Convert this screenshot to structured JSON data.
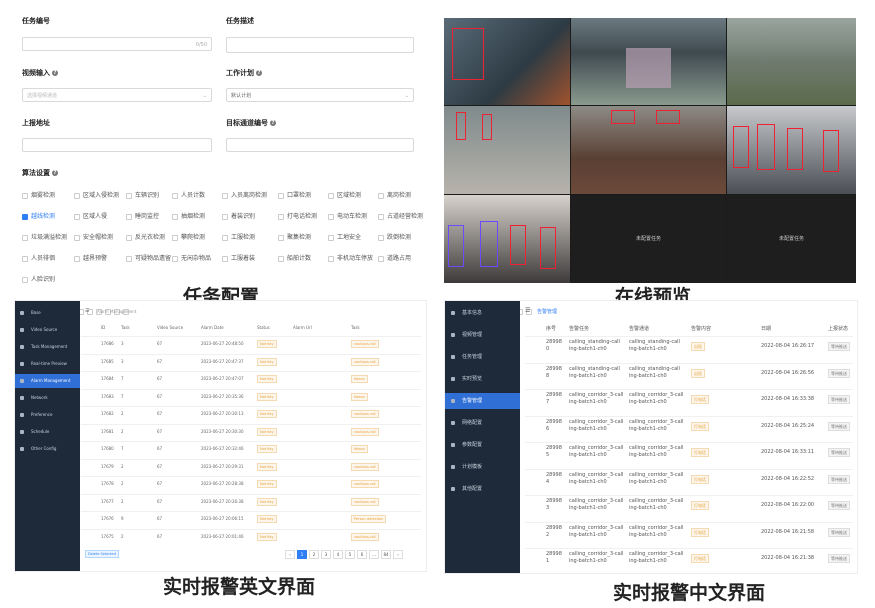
{
  "task_config": {
    "fields": {
      "task_id_label": "任务编号",
      "task_id_counter": "0/50",
      "task_desc_label": "任务描述",
      "video_input_label": "视频输入",
      "video_input_placeholder": "选择视频通道",
      "schedule_label": "工作计划",
      "schedule_value": "默认计划",
      "report_addr_label": "上报地址",
      "target_channel_label": "目标通道编号"
    },
    "algo_label": "算法设置",
    "algos": [
      {
        "label": "烟雾检测",
        "checked": false
      },
      {
        "label": "区域入侵检测",
        "checked": false
      },
      {
        "label": "车辆识别",
        "checked": false
      },
      {
        "label": "人员计数",
        "checked": false
      },
      {
        "label": "入员离岗检测",
        "checked": false
      },
      {
        "label": "口罩检测",
        "checked": false
      },
      {
        "label": "区域检测",
        "checked": false
      },
      {
        "label": "离岗检测",
        "checked": false
      },
      {
        "label": "越线检测",
        "checked": true
      },
      {
        "label": "区域人侵",
        "checked": false
      },
      {
        "label": "睡岗监控",
        "checked": false
      },
      {
        "label": "抽烟检测",
        "checked": false
      },
      {
        "label": "着装识别",
        "checked": false
      },
      {
        "label": "打电话检测",
        "checked": false
      },
      {
        "label": "电动车检测",
        "checked": false
      },
      {
        "label": "占道经营检测",
        "checked": false
      },
      {
        "label": "垃圾满溢检测",
        "checked": false
      },
      {
        "label": "安全帽检测",
        "checked": false
      },
      {
        "label": "反光衣检测",
        "checked": false
      },
      {
        "label": "攀爬检测",
        "checked": false
      },
      {
        "label": "工服检测",
        "checked": false
      },
      {
        "label": "聚集检测",
        "checked": false
      },
      {
        "label": "工地安全",
        "checked": false
      },
      {
        "label": "跌倒检测",
        "checked": false
      },
      {
        "label": "人员徘徊",
        "checked": false
      },
      {
        "label": "越界预警",
        "checked": false
      },
      {
        "label": "可疑物品遗留",
        "checked": false
      },
      {
        "label": "无闲杂物品",
        "checked": false
      },
      {
        "label": "工服着装",
        "checked": false
      },
      {
        "label": "船舶计数",
        "checked": false
      },
      {
        "label": "非机动车停放",
        "checked": false
      },
      {
        "label": "道路占用",
        "checked": false
      },
      {
        "label": "人脸识别",
        "checked": false
      }
    ],
    "caption": "任务配置"
  },
  "preview": {
    "no_channel_label_1": "未配置任务",
    "no_channel_label_2": "未配置任务",
    "caption": "在线预览"
  },
  "alarm_en": {
    "breadcrumb": "Alarm Management",
    "sidebar": [
      "Base",
      "Video Source",
      "Task Management",
      "Real-time Preview",
      "Alarm Management",
      "Network",
      "Preference",
      "Schedule",
      "Other Config"
    ],
    "active_index": 4,
    "columns": [
      "ID",
      "Task",
      "Video Source",
      "Alarm Date",
      "Status",
      "Alarm Url",
      "Task"
    ],
    "rows": [
      {
        "id": "17686",
        "task": "3",
        "src": "67",
        "date": "2023-06-27 20:48:50",
        "status": "Not Key",
        "task2": "cautious-roll"
      },
      {
        "id": "17685",
        "task": "3",
        "src": "67",
        "date": "2023-06-27 20:47:37",
        "status": "Not Key",
        "task2": "cautious-roll"
      },
      {
        "id": "17684",
        "task": "7",
        "src": "67",
        "date": "2023-06-27 20:47:07",
        "status": "Not Key",
        "task2": "faleon"
      },
      {
        "id": "17683",
        "task": "7",
        "src": "67",
        "date": "2023-06-27 20:35:36",
        "status": "Not Key",
        "task2": "faleon"
      },
      {
        "id": "17682",
        "task": "2",
        "src": "67",
        "date": "2023-06-27 20:30:13",
        "status": "Not Key",
        "task2": "cautious-roll"
      },
      {
        "id": "17681",
        "task": "2",
        "src": "67",
        "date": "2023-06-27 20:30:30",
        "status": "Not Key",
        "task2": "cautious-roll"
      },
      {
        "id": "17680",
        "task": "7",
        "src": "67",
        "date": "2023-06-27 20:32:46",
        "status": "Not Key",
        "task2": "faleon"
      },
      {
        "id": "17679",
        "task": "2",
        "src": "67",
        "date": "2023-06-27 20:29:31",
        "status": "Not Key",
        "task2": "cautious-roll"
      },
      {
        "id": "17678",
        "task": "2",
        "src": "67",
        "date": "2023-06-27 20:28:38",
        "status": "Not Key",
        "task2": "cautious-roll"
      },
      {
        "id": "17677",
        "task": "2",
        "src": "67",
        "date": "2023-06-27 20:26:38",
        "status": "Not Key",
        "task2": "cautious-roll"
      },
      {
        "id": "17676",
        "task": "9",
        "src": "67",
        "date": "2023-06-27 20:06:15",
        "status": "Not Key",
        "task2": "Person detection"
      },
      {
        "id": "17675",
        "task": "2",
        "src": "67",
        "date": "2023-06-27 20:01:46",
        "status": "Not Key",
        "task2": "cautious-roll"
      }
    ],
    "delete_button": "Delete Selected",
    "pages": [
      "‹",
      "1",
      "2",
      "3",
      "4",
      "5",
      "6",
      "…",
      "84",
      "›"
    ],
    "current_page": "1",
    "caption": "实时报警英文界面"
  },
  "alarm_cn": {
    "breadcrumb": "告警管理",
    "sidebar": [
      "基本信息",
      "视频管理",
      "任务管理",
      "实时预览",
      "告警管理",
      "网络配置",
      "参数配置",
      "计划模板",
      "其他配置"
    ],
    "active_index": 4,
    "columns": [
      "序号",
      "告警任务",
      "告警通道",
      "告警内容",
      "日期",
      "上报状态"
    ],
    "rows": [
      {
        "id": "28998\n0",
        "task": "calling_standing-call\ning-batch1-ch0",
        "chan": "calling_standing-call\ning-batch1-ch0",
        "content": "出现",
        "date": "2022-08-04 16:26:17",
        "state": "等待推送"
      },
      {
        "id": "28998\n8",
        "task": "calling_standing-call\ning-batch1-ch0",
        "chan": "calling_standing-call\ning-batch1-ch0",
        "content": "出现",
        "date": "2022-08-04 16:26:56",
        "state": "等待推送"
      },
      {
        "id": "28998\n7",
        "task": "calling_corridor_3-call\ning-batch1-ch0",
        "chan": "calling_corridor_3-call\ning-batch1-ch0",
        "content": "打电话",
        "date": "2022-08-04 16:33:38",
        "state": "等待推送"
      },
      {
        "id": "28998\n6",
        "task": "calling_corridor_3-call\ning-batch1-ch0",
        "chan": "calling_corridor_3-call\ning-batch1-ch0",
        "content": "打电话",
        "date": "2022-08-04 16:25:24",
        "state": "等待推送"
      },
      {
        "id": "28998\n5",
        "task": "calling_corridor_3-call\ning-batch1-ch0",
        "chan": "calling_corridor_3-call\ning-batch1-ch0",
        "content": "打电话",
        "date": "2022-08-04 16:33:11",
        "state": "等待推送"
      },
      {
        "id": "28998\n4",
        "task": "calling_corridor_3-call\ning-batch1-ch0",
        "chan": "calling_corridor_3-call\ning-batch1-ch0",
        "content": "打电话",
        "date": "2022-08-04 16:22:52",
        "state": "等待推送"
      },
      {
        "id": "28998\n3",
        "task": "calling_corridor_3-call\ning-batch1-ch0",
        "chan": "calling_corridor_3-call\ning-batch1-ch0",
        "content": "打电话",
        "date": "2022-08-04 16:22:00",
        "state": "等待推送"
      },
      {
        "id": "28998\n2",
        "task": "calling_corridor_3-call\ning-batch1-ch0",
        "chan": "calling_corridor_3-call\ning-batch1-ch0",
        "content": "打电话",
        "date": "2022-08-04 16:21:58",
        "state": "等待推送"
      },
      {
        "id": "28998\n1",
        "task": "calling_corridor_3-call\ning-batch1-ch0",
        "chan": "calling_corridor_3-call\ning-batch1-ch0",
        "content": "打电话",
        "date": "2022-08-04 16:21:38",
        "state": "等待推送"
      }
    ],
    "caption": "实时报警中文界面"
  },
  "colors": {
    "accent": "#2f7ef5",
    "sidebar": "#1e2a3a",
    "sidebar_active": "#2f6fd6",
    "warn": "#e6a23c"
  }
}
